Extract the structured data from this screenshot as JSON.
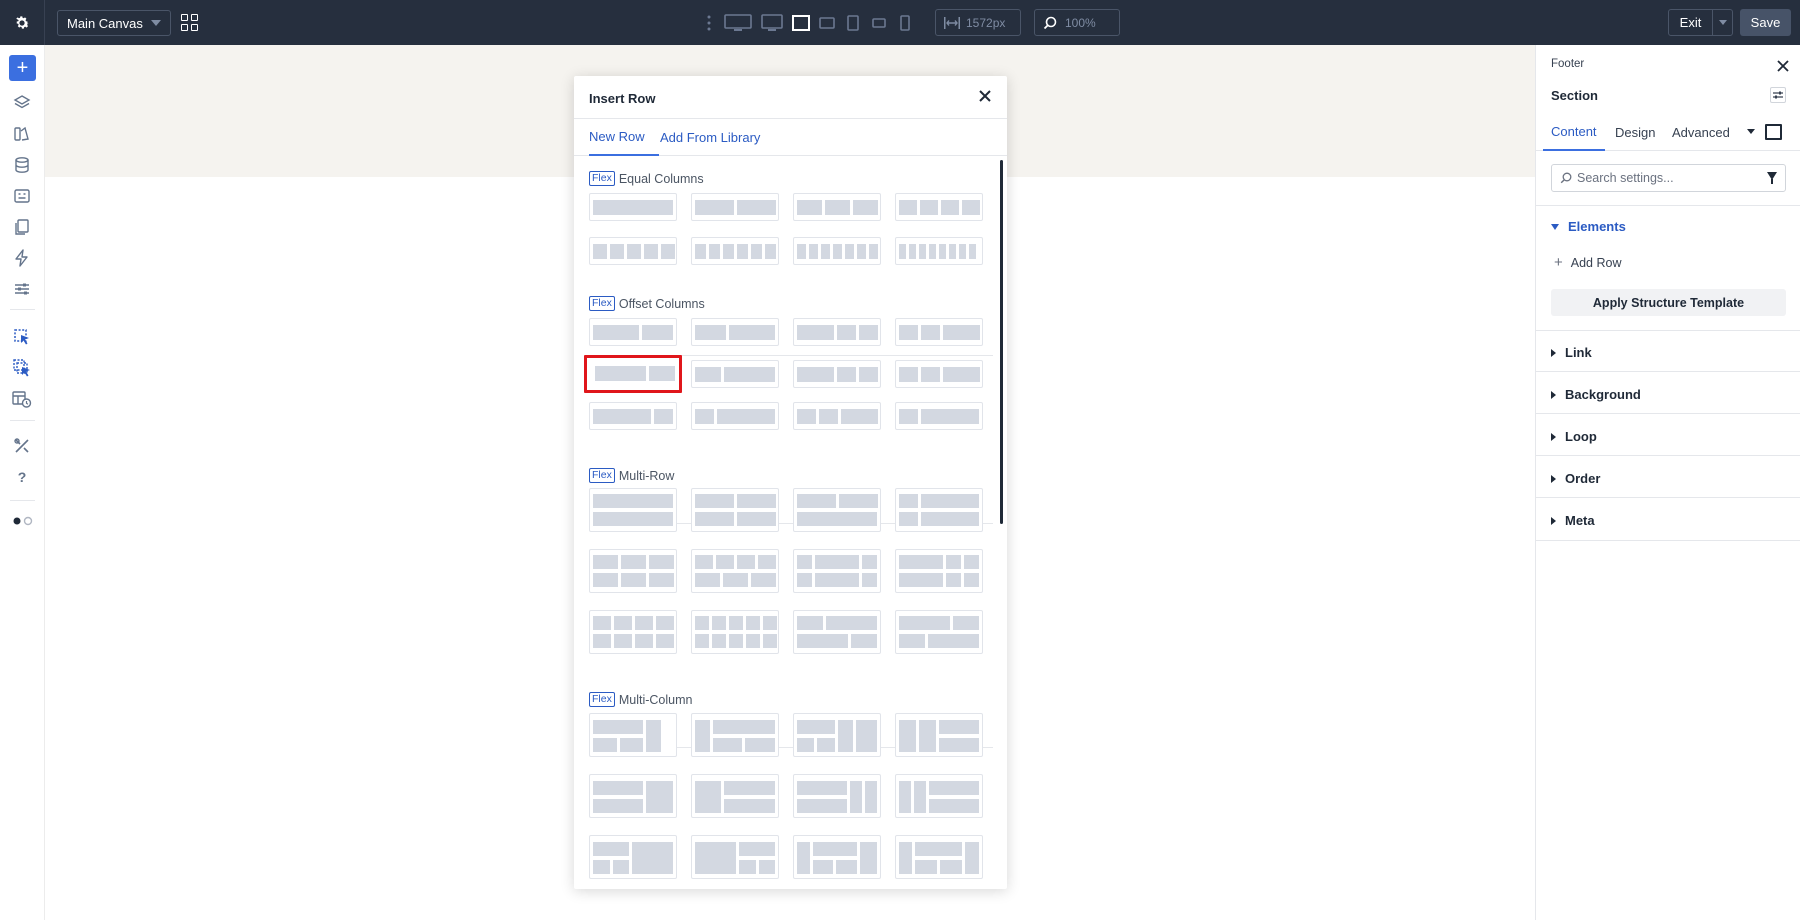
{
  "topbar": {
    "canvas_select": "Main Canvas",
    "width_value": "1572px",
    "zoom_value": "100%",
    "exit_label": "Exit",
    "save_label": "Save"
  },
  "modal": {
    "title": "Insert Row",
    "tabs": [
      "New Row",
      "Add From Library"
    ],
    "active_tab": "New Row",
    "badge": "Flex",
    "sections": [
      {
        "title": "Equal Columns"
      },
      {
        "title": "Offset Columns"
      },
      {
        "title": "Multi-Row"
      },
      {
        "title": "Multi-Column"
      }
    ],
    "highlighted_layout": "offset-columns row 2, column 1"
  },
  "panel": {
    "breadcrumb": "Footer",
    "element_title": "Section",
    "tabs": [
      "Content",
      "Design",
      "Advanced"
    ],
    "active_tab": "Content",
    "search_placeholder": "Search settings...",
    "groups": {
      "elements": "Elements",
      "add_row": "Add Row",
      "apply_template": "Apply Structure Template",
      "link": "Link",
      "background": "Background",
      "loop": "Loop",
      "order": "Order",
      "meta": "Meta"
    }
  },
  "colors": {
    "topbar_bg": "#262f3e",
    "accent": "#3b6fe0",
    "highlight": "#e0161b",
    "tile_block": "#d3d8e1",
    "canvas_band": "#f5f3ef"
  }
}
